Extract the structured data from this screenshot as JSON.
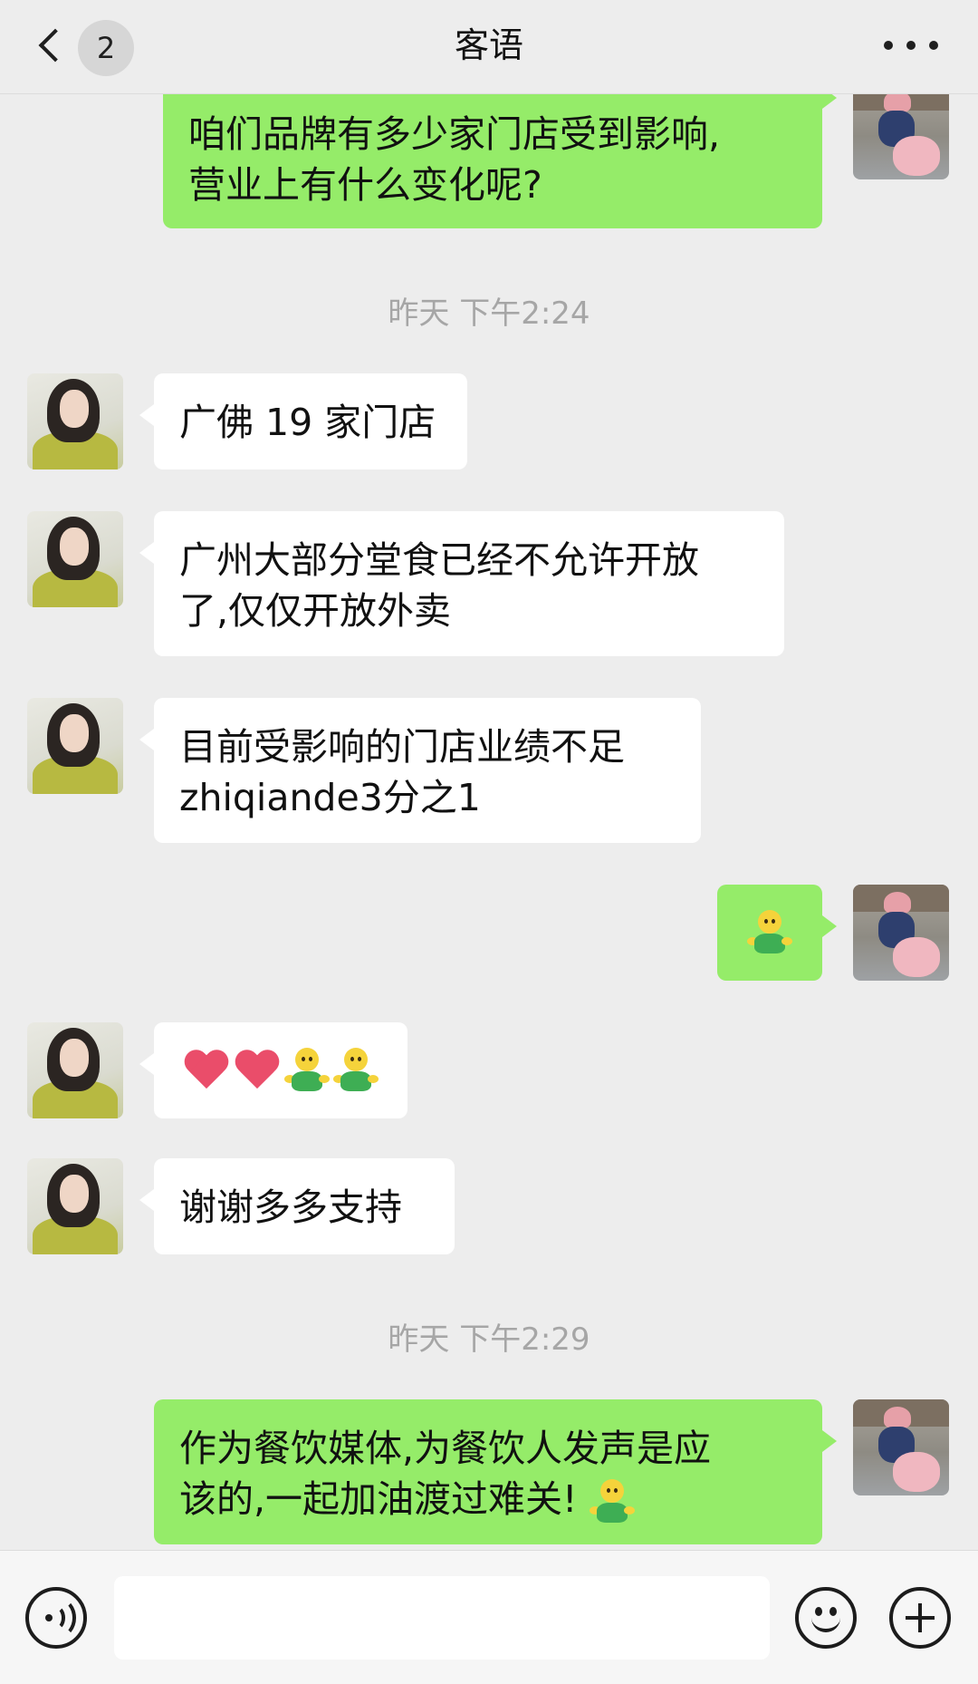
{
  "header": {
    "title": "客语",
    "unread_count": "2",
    "icons": {
      "back": "back-chevron-icon",
      "more": "more-dots-icon"
    }
  },
  "timestamps": [
    "昨天 下午2:24",
    "昨天 下午2:29"
  ],
  "messages": [
    {
      "sender": "me",
      "lines": [
        "咱们品牌有多少家门店受到影响,",
        "营业上有什么变化呢?"
      ]
    },
    {
      "sender": "them",
      "lines": [
        "广佛 19 家门店"
      ]
    },
    {
      "sender": "them",
      "lines": [
        "广州大部分堂食已经不允许开放",
        "了,仅仅开放外卖"
      ]
    },
    {
      "sender": "them",
      "lines": [
        "目前受影响的门店业绩不足",
        "zhiqiande3分之1"
      ]
    },
    {
      "sender": "me",
      "emoji": [
        "hug-emoji"
      ]
    },
    {
      "sender": "them",
      "emoji": [
        "heart-emoji",
        "heart-emoji",
        "hug-emoji",
        "hug-emoji"
      ]
    },
    {
      "sender": "them",
      "lines": [
        "谢谢多多支持"
      ]
    },
    {
      "sender": "me",
      "lines": [
        "作为餐饮媒体,为餐饮人发声是应",
        "该的,一起加油渡过难关!"
      ],
      "trailing_emoji": "hug-emoji"
    }
  ],
  "input_bar": {
    "placeholder": "",
    "icons": {
      "voice": "voice-icon",
      "emoji": "emoji-icon",
      "plus": "plus-icon"
    }
  },
  "colors": {
    "background": "#ededed",
    "bubble_me": "#95ec69",
    "bubble_them": "#ffffff",
    "timestamp": "#a6a6a6"
  }
}
